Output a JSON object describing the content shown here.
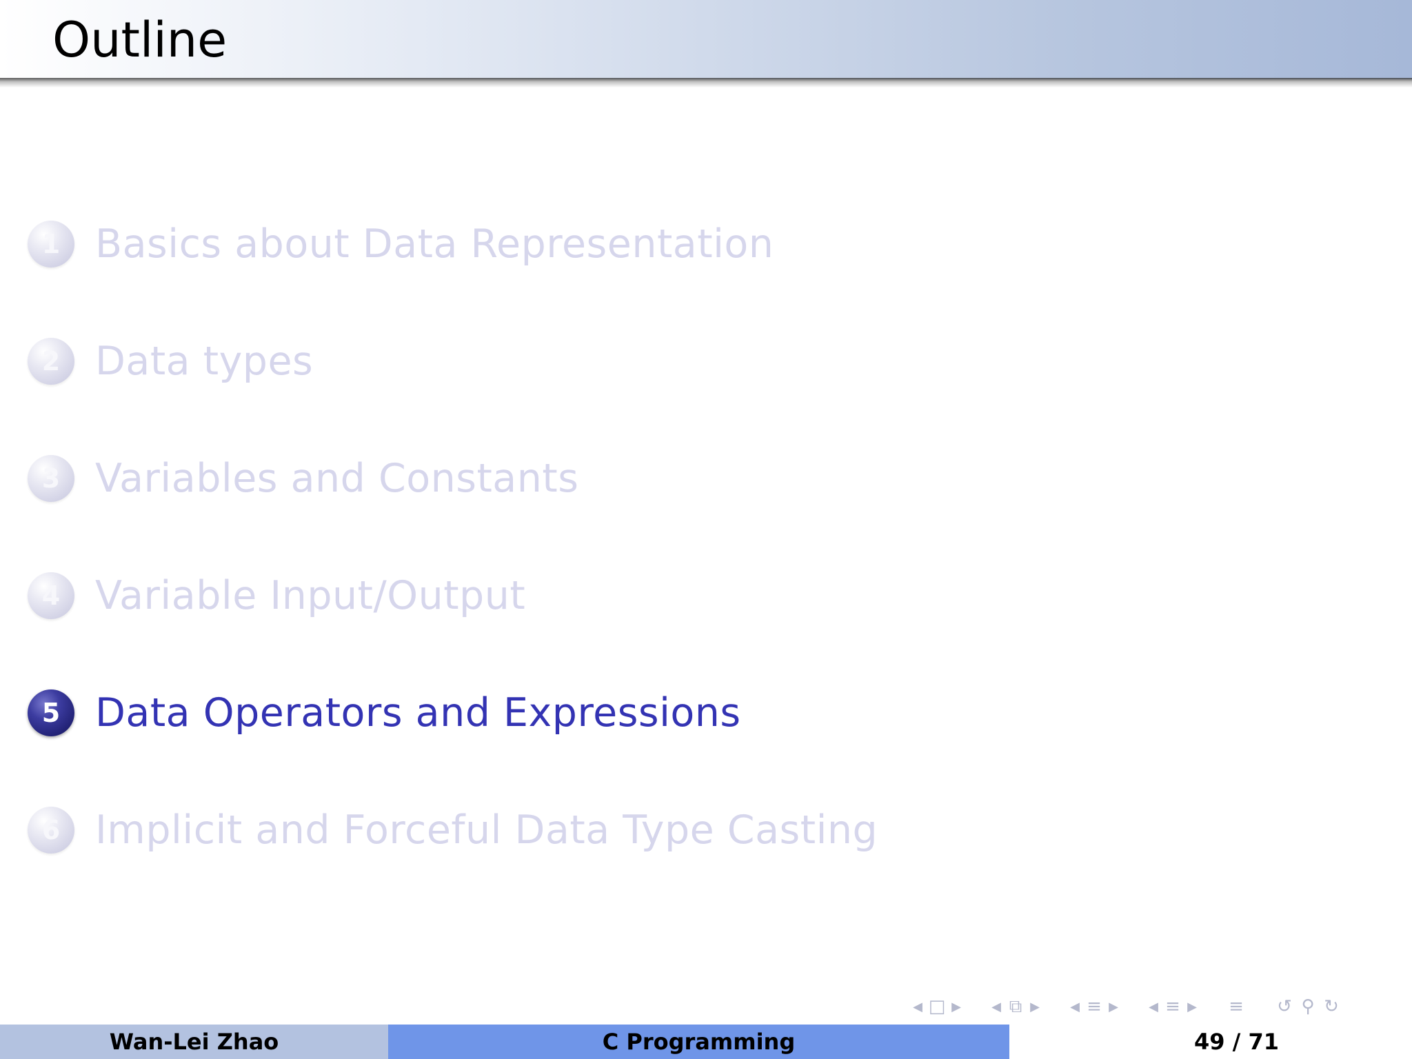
{
  "frame": {
    "title": "Outline"
  },
  "outline": {
    "items": [
      {
        "number": "1",
        "label": "Basics about Data Representation",
        "active": false
      },
      {
        "number": "2",
        "label": "Data types",
        "active": false
      },
      {
        "number": "3",
        "label": "Variables and Constants",
        "active": false
      },
      {
        "number": "4",
        "label": "Variable Input/Output",
        "active": false
      },
      {
        "number": "5",
        "label": "Data Operators and Expressions",
        "active": true
      },
      {
        "number": "6",
        "label": "Implicit and Forceful Data Type Casting",
        "active": false
      }
    ]
  },
  "navigation": {
    "icons": [
      "arrow-left-icon",
      "frame-icon",
      "arrow-right-icon",
      "arrow-left-icon",
      "subsection-icon",
      "arrow-right-icon",
      "arrow-left-icon",
      "section-icon",
      "arrow-right-icon",
      "arrow-left-icon",
      "subsubsection-icon",
      "arrow-right-icon",
      "toc-icon",
      "back-icon",
      "search-icon",
      "forward-icon"
    ]
  },
  "footer": {
    "author": "Wan-Lei Zhao",
    "course": "C Programming",
    "page": "49 / 71"
  },
  "colors": {
    "active_text": "#3333b3",
    "dim_text": "#d6d6ec",
    "footer_author_bg": "#b3c2e0",
    "footer_title_bg": "#6f95e8"
  }
}
